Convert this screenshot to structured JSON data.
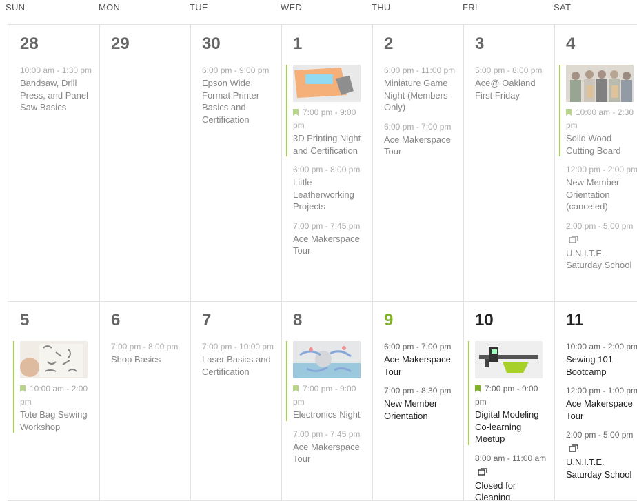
{
  "days_of_week": [
    "SUN",
    "MON",
    "TUE",
    "WED",
    "THU",
    "FRI",
    "SAT"
  ],
  "weeks": [
    {
      "days": [
        {
          "num": "28",
          "state": "past",
          "events": [
            {
              "time": "10:00 am - 1:30 pm",
              "title": "Bandsaw, Drill Press, and Panel Saw Basics",
              "featured": false,
              "recurring": false,
              "image": "",
              "faded": true
            }
          ]
        },
        {
          "num": "29",
          "state": "past",
          "events": []
        },
        {
          "num": "30",
          "state": "past",
          "events": [
            {
              "time": "6:00 pm - 9:00 pm",
              "title": "Epson Wide Format Printer Basics and Certification",
              "featured": false,
              "recurring": false,
              "image": "",
              "faded": true
            }
          ]
        },
        {
          "num": "1",
          "state": "past",
          "events": [
            {
              "time": "7:00 pm - 9:00 pm",
              "title": "3D Printing Night and Certification",
              "featured": true,
              "recurring": false,
              "image": "3d-printer-image",
              "faded": true
            },
            {
              "time": "6:00 pm - 8:00 pm",
              "title": "Little Leatherworking Projects",
              "featured": false,
              "recurring": false,
              "image": "",
              "faded": true
            },
            {
              "time": "7:00 pm - 7:45 pm",
              "title": "Ace Makerspace Tour",
              "featured": false,
              "recurring": false,
              "image": "",
              "faded": true
            }
          ]
        },
        {
          "num": "2",
          "state": "past",
          "events": [
            {
              "time": "6:00 pm - 11:00 pm",
              "title": "Miniature Game Night (Members Only)",
              "featured": false,
              "recurring": false,
              "image": "",
              "faded": true
            },
            {
              "time": "6:00 pm - 7:00 pm",
              "title": "Ace Makerspace Tour",
              "featured": false,
              "recurring": false,
              "image": "",
              "faded": true
            }
          ]
        },
        {
          "num": "3",
          "state": "past",
          "events": [
            {
              "time": "5:00 pm - 8:00 pm",
              "title": "Ace@ Oakland First Friday",
              "featured": false,
              "recurring": false,
              "image": "",
              "faded": true
            }
          ]
        },
        {
          "num": "4",
          "state": "past",
          "events": [
            {
              "time": "10:00 am - 2:30 pm",
              "title": "Solid Wood Cutting Board",
              "featured": true,
              "recurring": false,
              "image": "group-photo-image",
              "faded": true
            },
            {
              "time": "12:00 pm - 2:00 pm",
              "title": "New Member Orientation (canceled)",
              "featured": false,
              "recurring": false,
              "image": "",
              "faded": true
            },
            {
              "time": "2:00 pm - 5:00 pm",
              "title": "U.N.I.T.E. Saturday School",
              "featured": false,
              "recurring": true,
              "image": "",
              "faded": true
            }
          ]
        }
      ]
    },
    {
      "days": [
        {
          "num": "5",
          "state": "past",
          "events": [
            {
              "time": "10:00 am - 2:00 pm",
              "title": "Tote Bag Sewing Workshop",
              "featured": true,
              "recurring": false,
              "image": "tote-bag-image",
              "faded": true
            }
          ]
        },
        {
          "num": "6",
          "state": "past",
          "events": [
            {
              "time": "7:00 pm - 8:00 pm",
              "title": "Shop Basics",
              "featured": false,
              "recurring": false,
              "image": "",
              "faded": true
            }
          ]
        },
        {
          "num": "7",
          "state": "past",
          "events": [
            {
              "time": "7:00 pm - 10:00 pm",
              "title": "Laser Basics and Certification",
              "featured": false,
              "recurring": false,
              "image": "",
              "faded": true
            }
          ]
        },
        {
          "num": "8",
          "state": "past",
          "events": [
            {
              "time": "7:00 pm - 9:00 pm",
              "title": "Electronics Night",
              "featured": true,
              "recurring": false,
              "image": "electronics-image",
              "faded": true
            },
            {
              "time": "7:00 pm - 7:45 pm",
              "title": "Ace Makerspace Tour",
              "featured": false,
              "recurring": false,
              "image": "",
              "faded": true
            }
          ]
        },
        {
          "num": "9",
          "state": "today",
          "events": [
            {
              "time": "6:00 pm - 7:00 pm",
              "title": "Ace Makerspace Tour",
              "featured": false,
              "recurring": false,
              "image": "",
              "faded": false
            },
            {
              "time": "7:00 pm - 8:30 pm",
              "title": "New Member Orientation",
              "featured": false,
              "recurring": false,
              "image": "",
              "faded": false
            }
          ]
        },
        {
          "num": "10",
          "state": "future",
          "events": [
            {
              "time": "7:00 pm - 9:00 pm",
              "title": "Digital Modeling Co-learning Meetup",
              "featured": true,
              "recurring": false,
              "image": "caliper-image",
              "faded": false
            },
            {
              "time": "8:00 am - 11:00 am",
              "title": "Closed for Cleaning",
              "featured": false,
              "recurring": true,
              "image": "",
              "faded": false
            }
          ]
        },
        {
          "num": "11",
          "state": "future",
          "events": [
            {
              "time": "10:00 am - 2:00 pm",
              "title": "Sewing 101 Bootcamp",
              "featured": false,
              "recurring": false,
              "image": "",
              "faded": false
            },
            {
              "time": "12:00 pm - 1:00 pm",
              "title": "Ace Makerspace Tour",
              "featured": false,
              "recurring": false,
              "image": "",
              "faded": false
            },
            {
              "time": "2:00 pm - 5:00 pm",
              "title": "U.N.I.T.E. Saturday School",
              "featured": false,
              "recurring": true,
              "image": "",
              "faded": false
            }
          ]
        }
      ]
    }
  ],
  "colors": {
    "accent": "#7fb127",
    "featured_bar": "#a5cf5a",
    "grid_line": "#e2e2e2"
  }
}
